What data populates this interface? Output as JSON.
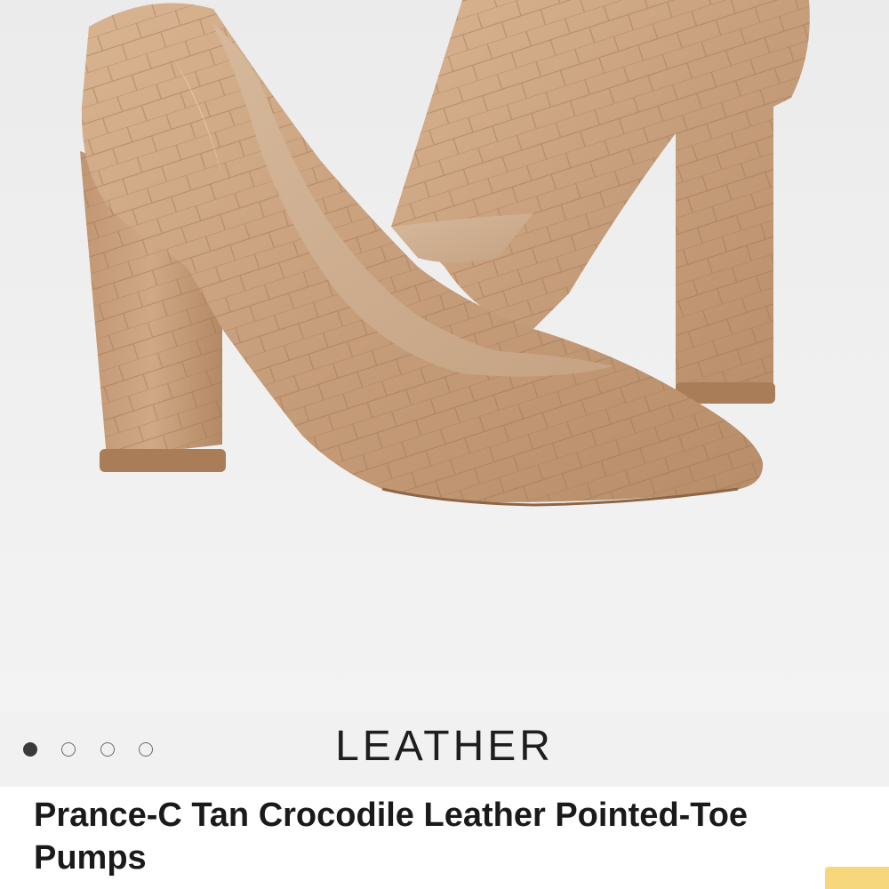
{
  "gallery": {
    "image_alt": "Tan crocodile-embossed leather pointed-toe block heel pumps",
    "dots": [
      {
        "active": true
      },
      {
        "active": false
      },
      {
        "active": false
      },
      {
        "active": false
      }
    ],
    "material_label": "LEATHER"
  },
  "product": {
    "title": "Prance-C Tan Crocodile Leather Pointed-Toe Pumps"
  },
  "colors": {
    "leather": "#c9a17e",
    "leather_dark": "#a87f5c",
    "background": "#efefef",
    "promo": "#f6d77c"
  }
}
